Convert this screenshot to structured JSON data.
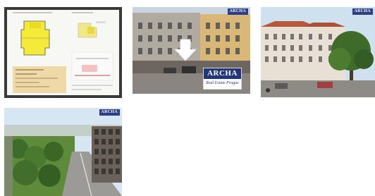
{
  "gallery": {
    "images": [
      {
        "id": "floorplan",
        "kind": "floor-plan sheet"
      },
      {
        "id": "facade",
        "kind": "building facade",
        "brand": "ARCHA",
        "tagline": "Real Estate Prague",
        "badge": "ARCHA"
      },
      {
        "id": "street",
        "kind": "street view",
        "badge": "ARCHA"
      },
      {
        "id": "aerial",
        "kind": "aerial view",
        "badge": "ARCHA"
      }
    ]
  },
  "colors": {
    "brand_blue": "#23367a",
    "plan_yellow": "#f4ea3a",
    "plan_tan": "#f0d9a8"
  }
}
